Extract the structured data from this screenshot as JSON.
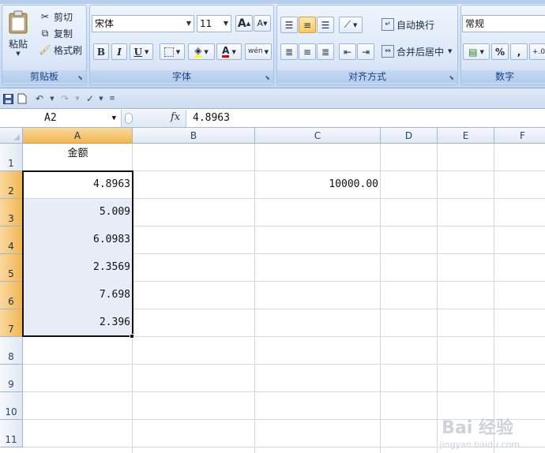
{
  "ribbon": {
    "clipboard": {
      "label": "剪贴板",
      "paste": "粘贴",
      "cut": "剪切",
      "copy": "复制",
      "format_painter": "格式刷"
    },
    "font": {
      "label": "字体",
      "font_name": "宋体",
      "font_size": "11",
      "bold": "B",
      "italic": "I",
      "underline": "U",
      "grow": "A",
      "shrink": "A",
      "font_color_letter": "A",
      "phonetic": "wén"
    },
    "alignment": {
      "label": "对齐方式",
      "wrap_text": "自动换行",
      "merge_center": "合并后居中"
    },
    "number": {
      "label": "数字",
      "format": "常规",
      "percent": "%",
      "comma": ",",
      "decimal": "+.0"
    }
  },
  "formula_bar": {
    "name_box": "A2",
    "fx": "fx",
    "formula": "4.8963"
  },
  "grid": {
    "columns": [
      "A",
      "B",
      "C",
      "D",
      "E",
      "F"
    ],
    "rows": [
      "1",
      "2",
      "3",
      "4",
      "5",
      "6",
      "7",
      "8",
      "9",
      "10",
      "11"
    ],
    "selected_column": "A",
    "selected_rows": [
      "2",
      "3",
      "4",
      "5",
      "6",
      "7"
    ],
    "cells": {
      "A1": "金额",
      "A2": "4.8963",
      "A3": "5.009",
      "A4": "6.0983",
      "A5": "2.3569",
      "A6": "7.698",
      "A7": "2.396",
      "C2": "10000.00"
    }
  },
  "watermark": {
    "brand": "Bai 经验",
    "url": "jingyan.baidu.com"
  }
}
